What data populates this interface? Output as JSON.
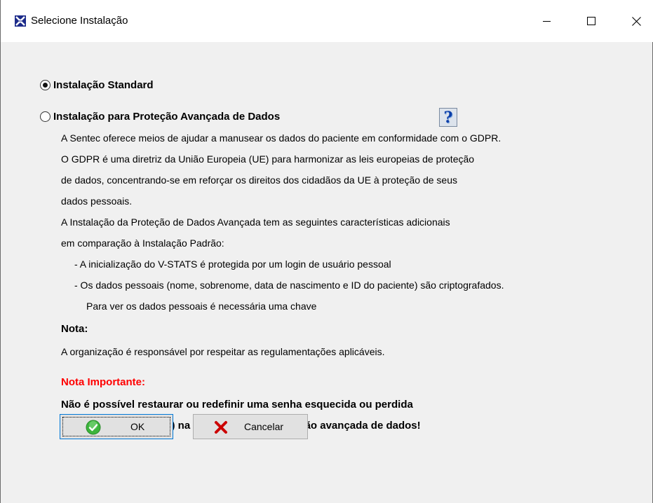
{
  "window": {
    "title": "Selecione Instalação",
    "controls": {
      "minimize": "minimize",
      "maximize": "maximize",
      "close": "close"
    }
  },
  "options": {
    "standard": {
      "label": "Instalação Standard",
      "selected": true
    },
    "advanced": {
      "label": "Instalação para Proteção Avançada de Dados",
      "selected": false
    }
  },
  "help_button": {
    "label": "?"
  },
  "description": {
    "lines": [
      "A Sentec oferece meios de ajudar a manusear os dados do paciente em conformidade com o GDPR.",
      "O GDPR é uma diretriz da União Europeia (UE) para harmonizar as leis europeias de proteção",
      " de dados, concentrando-se em reforçar os direitos dos cidadãos da UE à proteção de seus",
      "dados pessoais.",
      "A Instalação da Proteção de Dados Avançada tem as seguintes características adicionais",
      "em comparação à Instalação Padrão:",
      "- A inicialização do V-STATS é protegida por um login de usuário pessoal",
      "- Os dados pessoais (nome, sobrenome, data de nascimento e ID do paciente) são criptografados.",
      "Para ver os dados pessoais é necessária uma chave"
    ]
  },
  "note": {
    "heading": "Nota:",
    "text": "A organização é responsável por respeitar as regulamentações aplicáveis."
  },
  "important": {
    "heading": "Nota Importante:",
    "line1": "Não é possível restaurar ou redefinir uma senha esquecida ou perdida",
    "line2": "(administrador e login) na instalação para proteção avançada de dados!"
  },
  "buttons": {
    "ok": "OK",
    "cancel": "Cancelar"
  },
  "colors": {
    "important": "#ff0000",
    "ok_icon": "#3cb43c",
    "cancel_icon": "#cc0000"
  }
}
